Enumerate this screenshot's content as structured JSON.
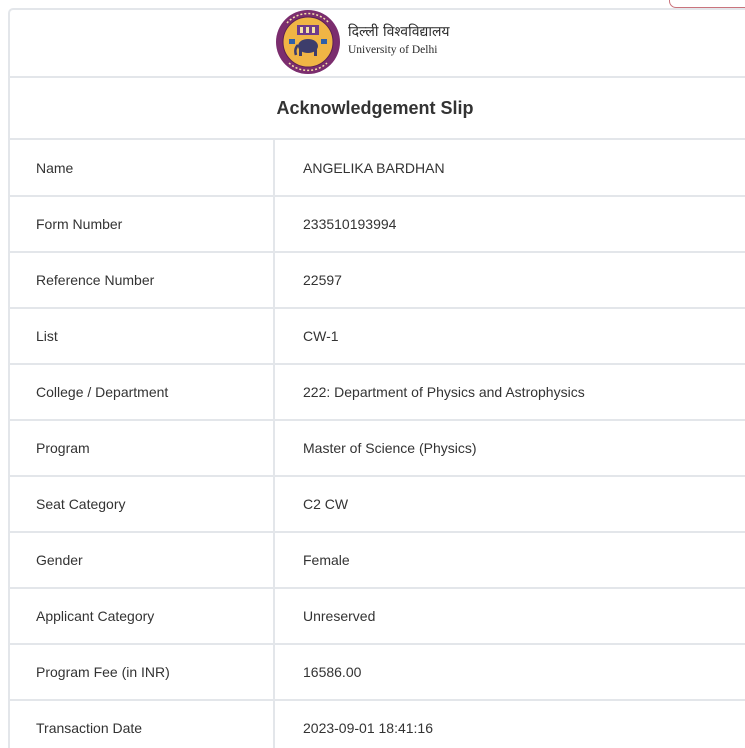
{
  "header": {
    "university_name_hindi": "दिल्ली विश्वविद्यालय",
    "university_name_english": "University of Delhi",
    "logo_icon": "university-seal-icon"
  },
  "slip": {
    "title": "Acknowledgement Slip",
    "rows": [
      {
        "label": "Name",
        "value": "ANGELIKA BARDHAN"
      },
      {
        "label": "Form Number",
        "value": "233510193994"
      },
      {
        "label": "Reference Number",
        "value": "22597"
      },
      {
        "label": "List",
        "value": "CW-1"
      },
      {
        "label": "College / Department",
        "value": "222: Department of Physics and Astrophysics"
      },
      {
        "label": "Program",
        "value": "Master of Science (Physics)"
      },
      {
        "label": "Seat Category",
        "value": "C2 CW"
      },
      {
        "label": "Gender",
        "value": "Female"
      },
      {
        "label": "Applicant Category",
        "value": "Unreserved"
      },
      {
        "label": "Program Fee (in INR)",
        "value": "16586.00"
      },
      {
        "label": "Transaction Date",
        "value": "2023-09-01 18:41:16"
      }
    ]
  },
  "colors": {
    "border": "#e3e6ea",
    "text": "#333333",
    "button_outline": "#c9747d",
    "seal_outer": "#7b2d6e",
    "seal_inner": "#f0b545"
  }
}
